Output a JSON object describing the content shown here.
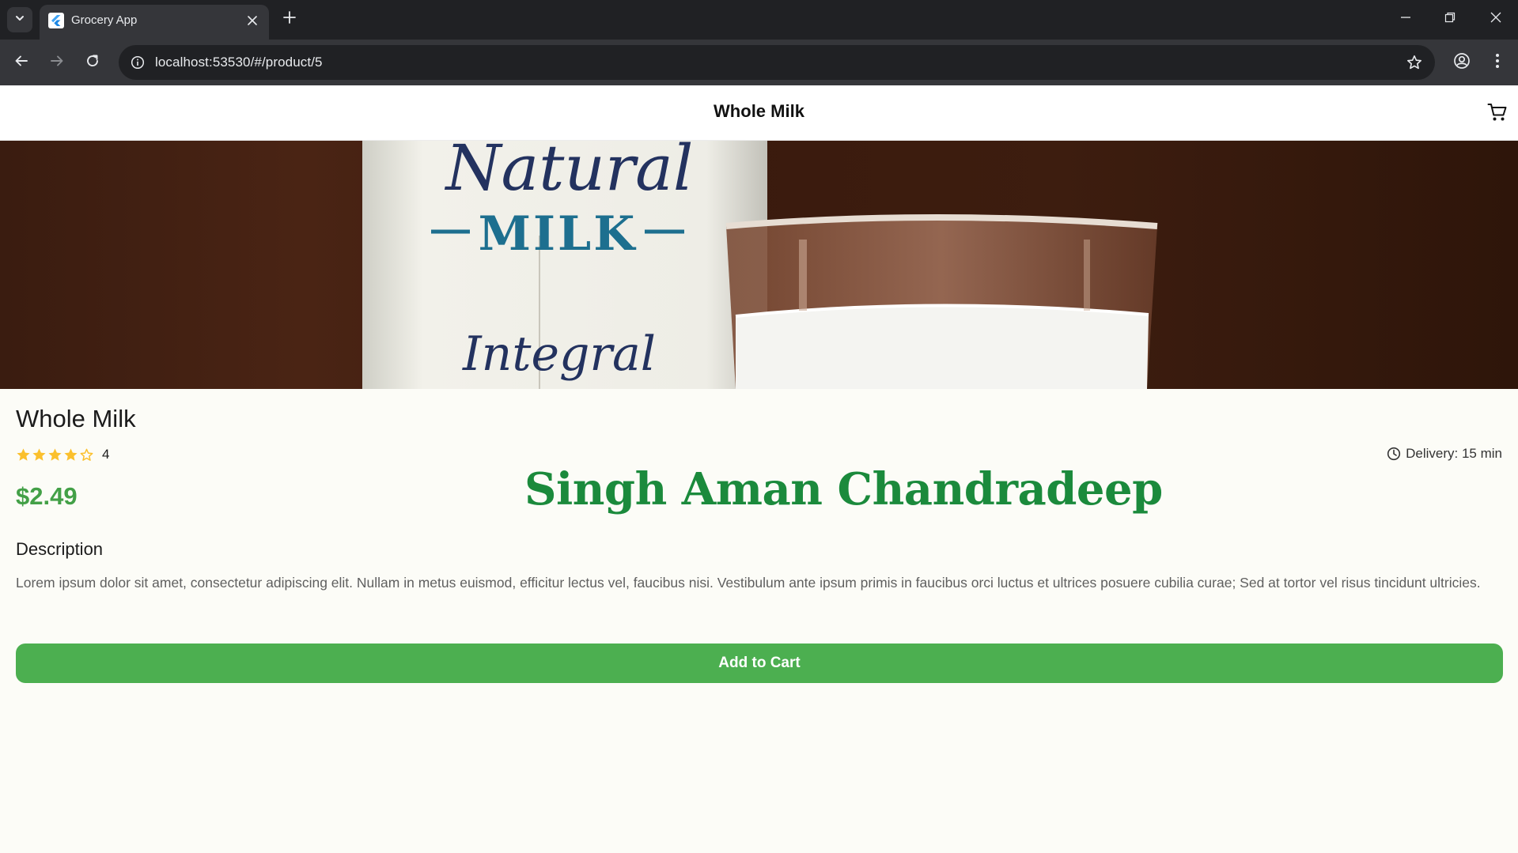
{
  "browser": {
    "tab_title": "Grocery App",
    "url": "localhost:53530/#/product/5"
  },
  "app": {
    "appbar_title": "Whole Milk",
    "hero_image": {
      "carton_text_top": "Natural",
      "carton_text_middle": "MILK",
      "carton_text_bottom": "Integral"
    },
    "product": {
      "name": "Whole Milk",
      "rating": 4,
      "rating_label": "4",
      "max_rating": 5,
      "delivery": "Delivery: 15 min",
      "price": "$2.49",
      "description_heading": "Description",
      "description": "Lorem ipsum dolor sit amet, consectetur adipiscing elit. Nullam in metus euismod, efficitur lectus vel, faucibus nisi. Vestibulum ante ipsum primis in faucibus orci luctus et ultrices posuere cubilia curae; Sed at tortor vel risus tincidunt ultricies."
    },
    "watermark": "Singh Aman Chandradeep",
    "add_to_cart_label": "Add to Cart"
  },
  "colors": {
    "accent_green": "#4caf50",
    "price_green": "#43a047",
    "star_yellow": "#fbc02d",
    "watermark_green": "#1b8a3c"
  },
  "icons": [
    "chevron-down-icon",
    "flutter-icon",
    "close-icon",
    "plus-icon",
    "minimize-icon",
    "restore-icon",
    "back-icon",
    "forward-icon",
    "reload-icon",
    "info-icon",
    "star-outline-icon",
    "account-icon",
    "more-vert-icon",
    "cart-icon",
    "star-icon",
    "clock-icon"
  ]
}
